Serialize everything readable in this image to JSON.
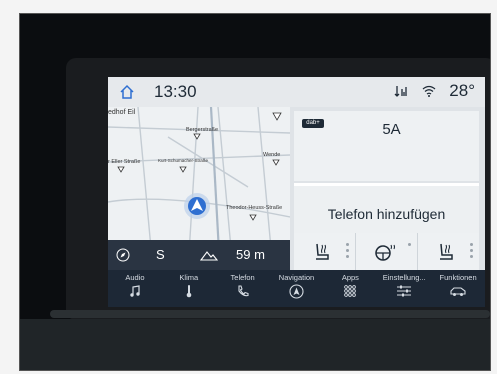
{
  "status": {
    "time": "13:30",
    "temperature": "28°"
  },
  "map": {
    "streets": [
      "edhof Eil",
      "Bergerstraße",
      "Wende",
      "r Eller Straße",
      "Kurt-Schumacher-Straße",
      "Theodor-Heuss-Straße"
    ],
    "heading": "S",
    "distance": "59 m"
  },
  "radio": {
    "badge": "dab+",
    "station": "5A"
  },
  "phone": {
    "label": "Telefon hinzufügen"
  },
  "nav": {
    "items": [
      {
        "label": "Audio",
        "icon": "music-note-icon"
      },
      {
        "label": "Klima",
        "icon": "thermometer-icon"
      },
      {
        "label": "Telefon",
        "icon": "phone-icon"
      },
      {
        "label": "Navigation",
        "icon": "navigation-arrow-icon"
      },
      {
        "label": "Apps",
        "icon": "apps-grid-icon"
      },
      {
        "label": "Einstellung...",
        "icon": "settings-sliders-icon"
      },
      {
        "label": "Funktionen",
        "icon": "car-icon"
      }
    ]
  },
  "colors": {
    "nav_bg": "#1d2836",
    "screen_bg": "#dfe3e7",
    "accent": "#2f6fd1"
  }
}
